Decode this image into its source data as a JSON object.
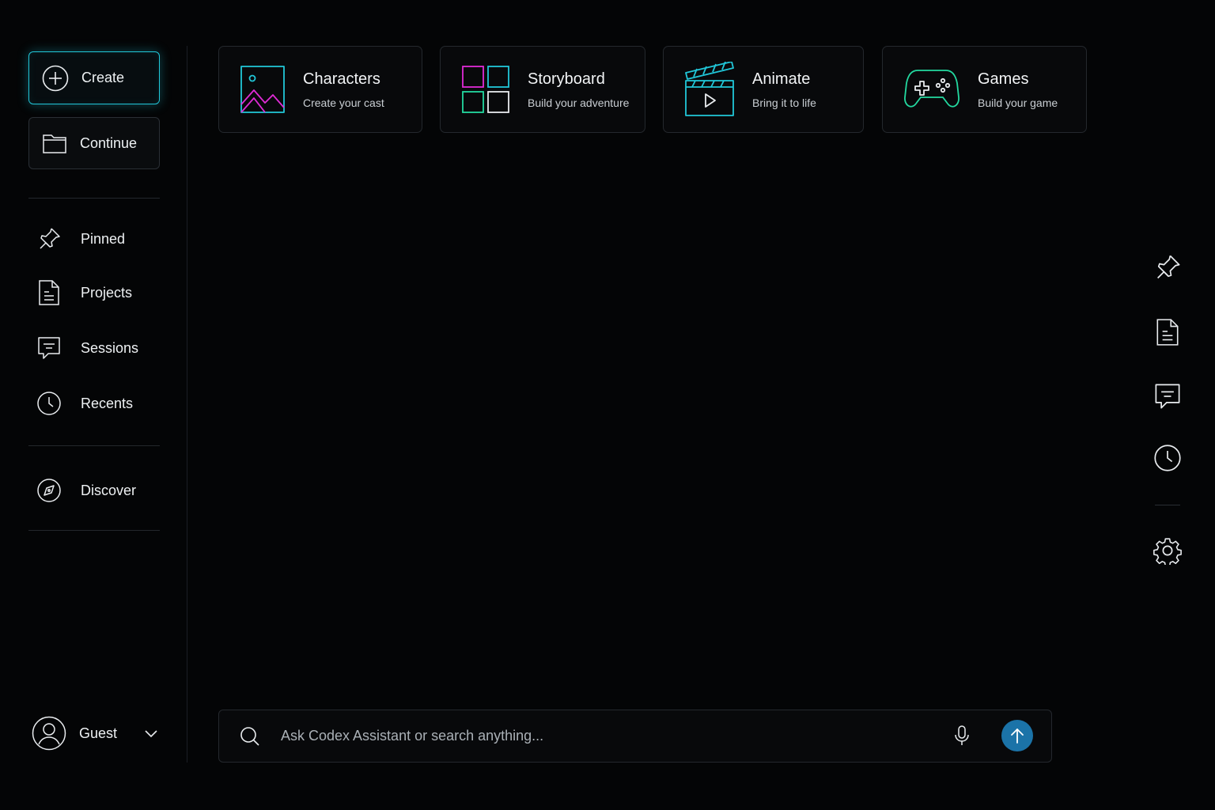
{
  "sidebar": {
    "create_label": "Create",
    "continue_label": "Continue",
    "nav": [
      {
        "label": "Pinned",
        "icon": "pin-icon"
      },
      {
        "label": "Projects",
        "icon": "document-icon"
      },
      {
        "label": "Sessions",
        "icon": "chat-bubble-icon"
      },
      {
        "label": "Recents",
        "icon": "clock-icon"
      }
    ],
    "discover_label": "Discover",
    "user_label": "Guest"
  },
  "cards": [
    {
      "title": "Characters",
      "subtitle": "Create your cast",
      "icon": "image-icon"
    },
    {
      "title": "Storyboard",
      "subtitle": "Build your adventure",
      "icon": "grid-icon"
    },
    {
      "title": "Animate",
      "subtitle": "Bring it to life",
      "icon": "clapperboard-icon"
    },
    {
      "title": "Games",
      "subtitle": "Build your game",
      "icon": "gamepad-icon"
    }
  ],
  "right_rail": [
    "pin-icon",
    "document-icon",
    "chat-bubble-icon",
    "clock-icon",
    "settings-gear-icon"
  ],
  "search": {
    "placeholder": "Ask Codex Assistant or search anything..."
  },
  "colors": {
    "accent_cyan": "#21c7d9",
    "accent_magenta": "#e02bd6",
    "accent_green": "#23d9a0",
    "send_button": "#1b73a8",
    "background": "#040506"
  }
}
